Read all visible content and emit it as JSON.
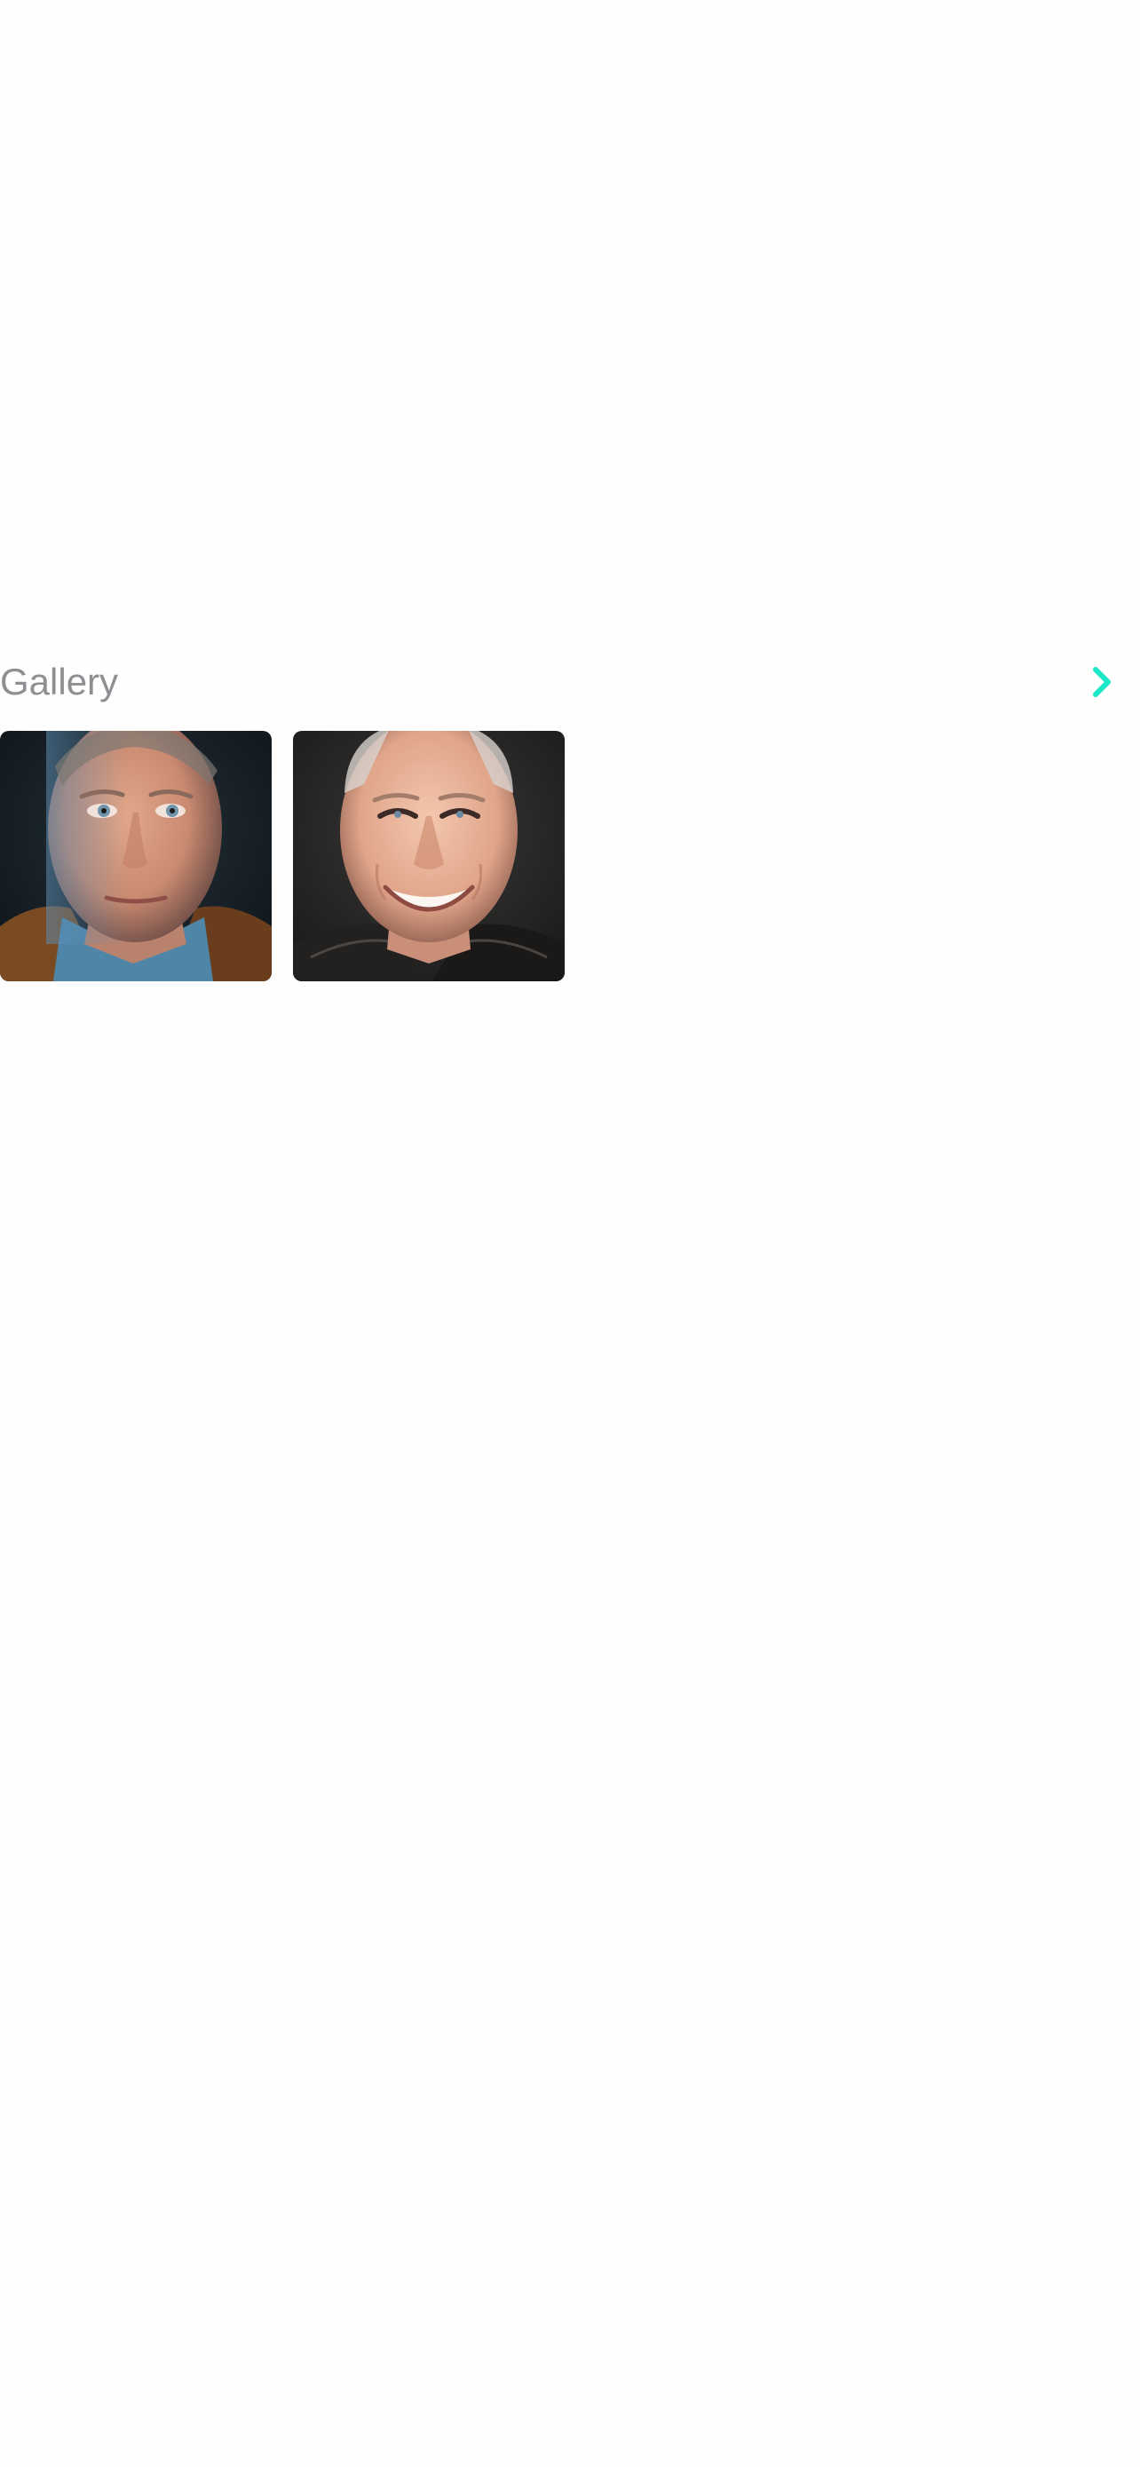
{
  "gallery": {
    "title": "Gallery",
    "more_icon": "chevron-right-icon",
    "accent_color": "#1de9c8",
    "photos": [
      {
        "name": "portrait-serious-blue-shirt"
      },
      {
        "name": "portrait-smiling-leather-jacket"
      }
    ]
  }
}
